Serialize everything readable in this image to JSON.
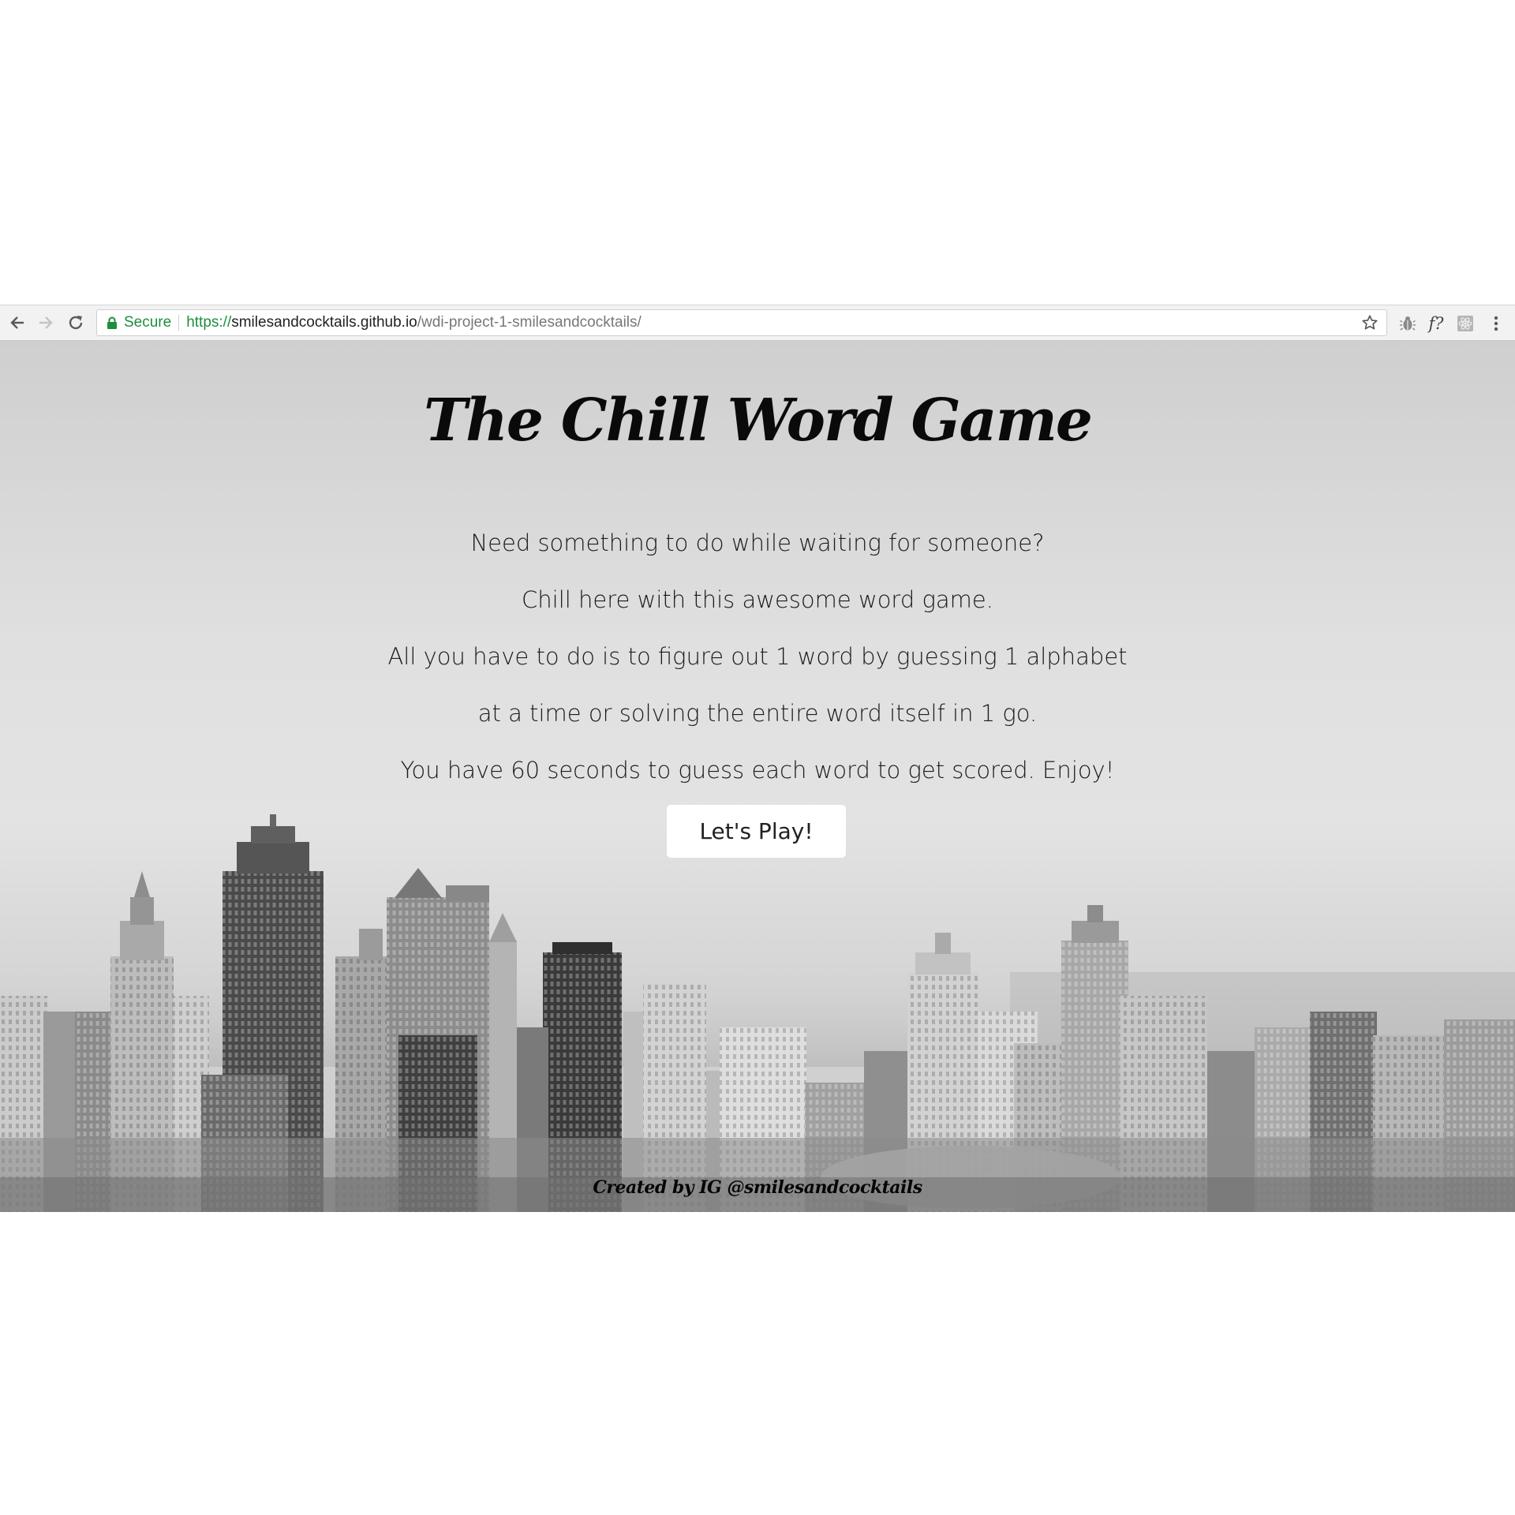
{
  "browser": {
    "secure_label": "Secure",
    "url_scheme": "https://",
    "url_host": "smilesandcocktails.github.io",
    "url_path": "/wdi-project-1-smilesandcocktails/",
    "extensions": [
      "bug-icon",
      "font-identifier-icon",
      "react-icon"
    ],
    "extension_font_label": "f?"
  },
  "page": {
    "title": "The Chill Word Game",
    "intro_lines": [
      "Need something to do while waiting for someone?",
      "Chill here with this awesome word game.",
      "All you have to do is to figure out 1 word by guessing 1 alphabet",
      "at a time or solving the entire word itself in 1 go.",
      "You have 60 seconds to guess each word to get scored. Enjoy!"
    ],
    "play_label": "Let's Play!",
    "credit": "Created by IG @smilesandcocktails"
  },
  "colors": {
    "secure_green": "#1e8e3e",
    "button_bg": "#ffffff",
    "text": "#0a0a0a"
  }
}
